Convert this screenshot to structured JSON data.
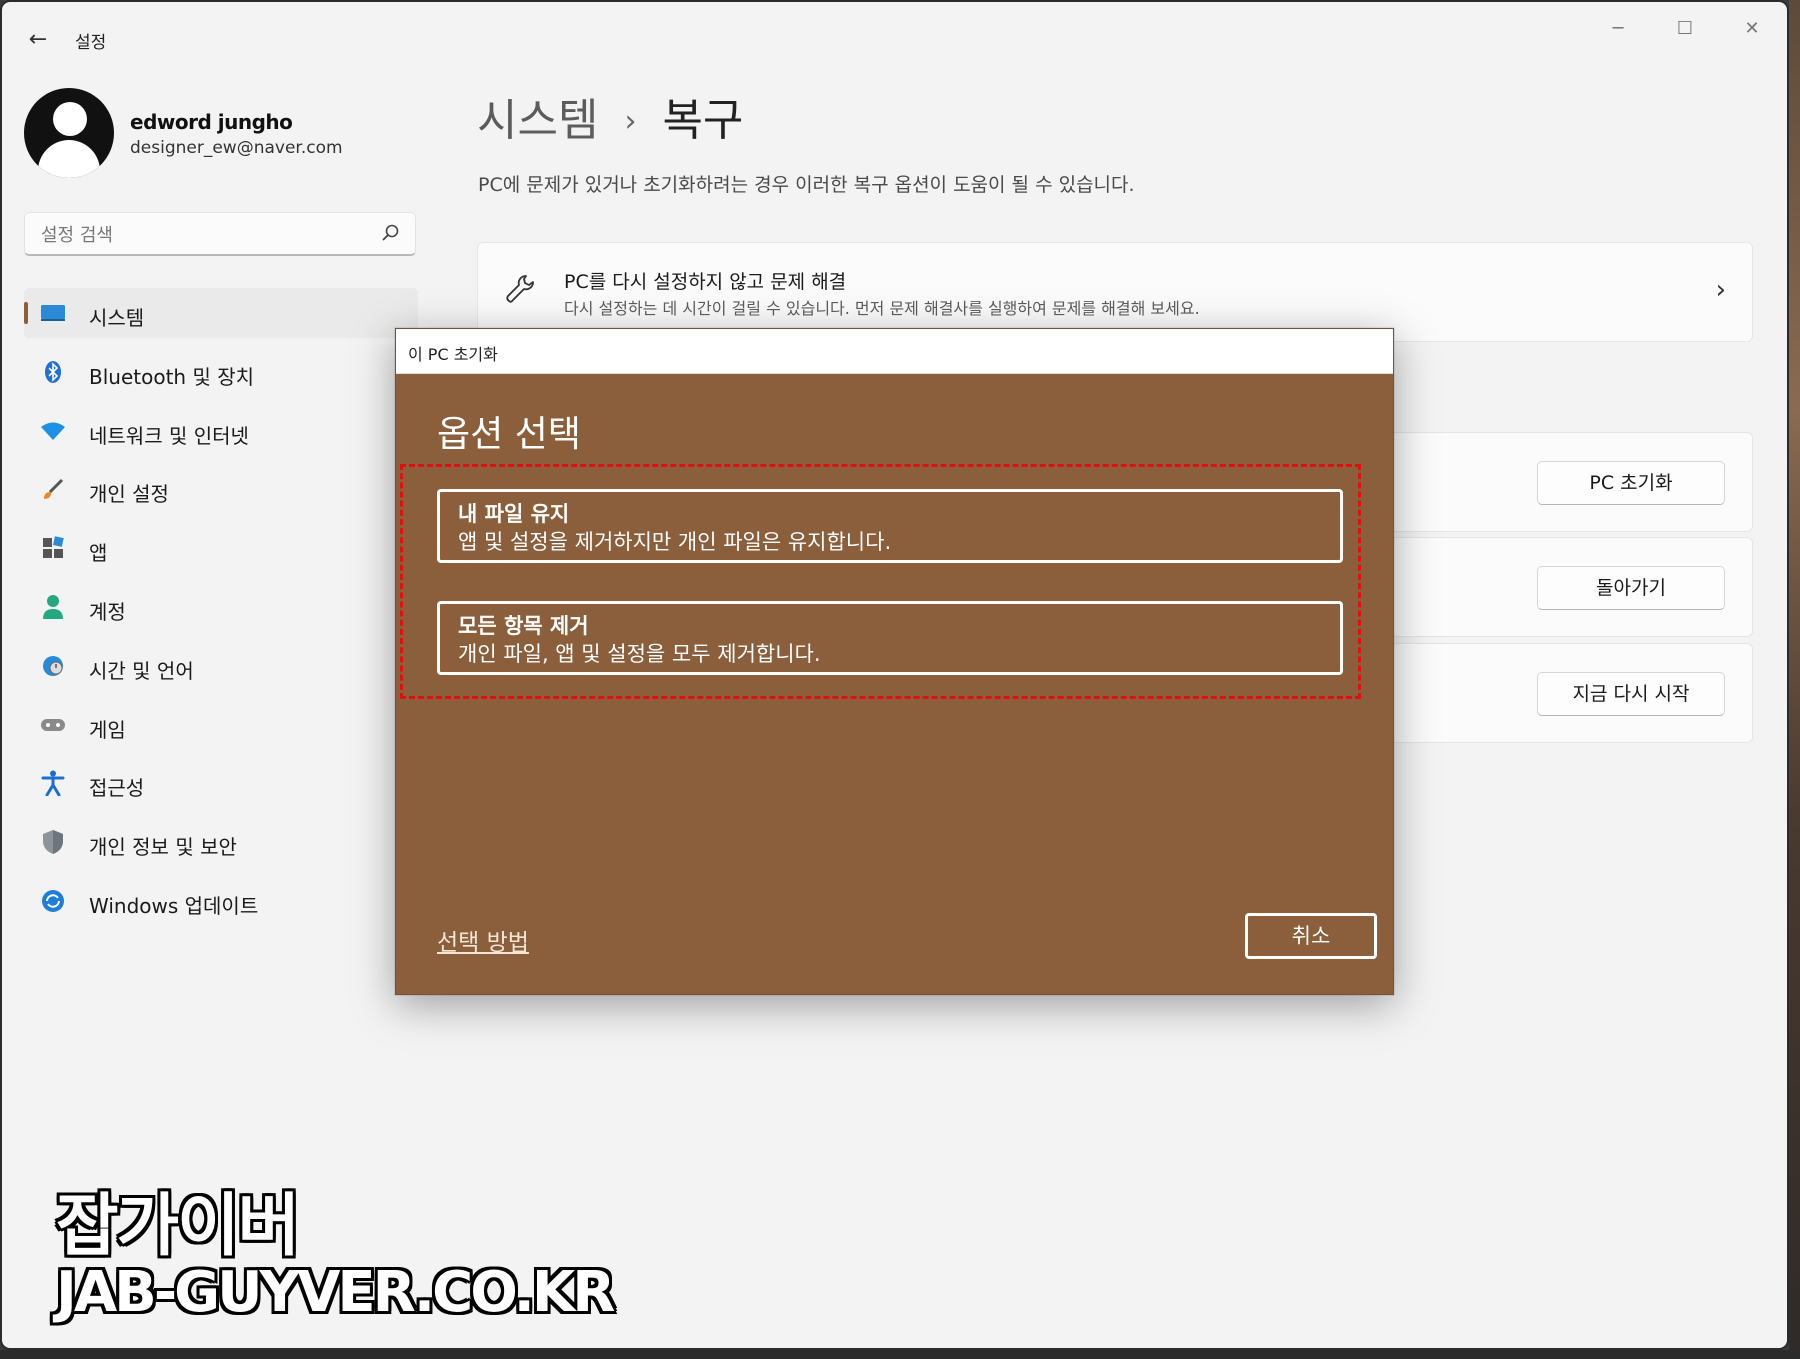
{
  "app": {
    "title": "설정",
    "back_icon": "back-arrow-icon"
  },
  "window_controls": {
    "minimize": "─",
    "maximize": "☐",
    "close": "✕"
  },
  "profile": {
    "name": "edword jungho",
    "email": "designer_ew@naver.com"
  },
  "search": {
    "placeholder": "설정 검색"
  },
  "sidebar": {
    "items": [
      {
        "label": "시스템",
        "icon": "system-icon",
        "active": true
      },
      {
        "label": "Bluetooth 및 장치",
        "icon": "bluetooth-icon"
      },
      {
        "label": "네트워크 및 인터넷",
        "icon": "wifi-icon"
      },
      {
        "label": "개인 설정",
        "icon": "brush-icon"
      },
      {
        "label": "앱",
        "icon": "apps-icon"
      },
      {
        "label": "계정",
        "icon": "account-icon"
      },
      {
        "label": "시간 및 언어",
        "icon": "globe-icon"
      },
      {
        "label": "게임",
        "icon": "gamepad-icon"
      },
      {
        "label": "접근성",
        "icon": "accessibility-icon"
      },
      {
        "label": "개인 정보 및 보안",
        "icon": "shield-icon"
      },
      {
        "label": "Windows 업데이트",
        "icon": "update-icon"
      }
    ]
  },
  "header": {
    "breadcrumb_parent": "시스템",
    "breadcrumb_sep": "›",
    "breadcrumb_current": "복구",
    "description": "PC에 문제가 있거나 초기화하려는 경우 이러한 복구 옵션이 도움이 될 수 있습니다."
  },
  "troubleshoot_card": {
    "title": "PC를 다시 설정하지 않고 문제 해결",
    "subtitle": "다시 설정하는 데 시간이 걸릴 수 있습니다. 먼저 문제 해결사를 실행하여 문제를 해결해 보세요."
  },
  "recovery_actions": {
    "reset_pc": "PC 초기화",
    "go_back": "돌아가기",
    "restart_now": "지금 다시 시작"
  },
  "dialog": {
    "window_title": "이 PC 초기화",
    "heading": "옵션 선택",
    "options": [
      {
        "title": "내 파일 유지",
        "description": "앱 및 설정을 제거하지만 개인 파일은 유지합니다."
      },
      {
        "title": "모든 항목 제거",
        "description": "개인 파일, 앱 및 설정을 모두 제거합니다."
      }
    ],
    "help_link": "선택 방법",
    "cancel": "취소",
    "colors": {
      "background": "#8b5e3c",
      "highlight": "#e01010"
    }
  },
  "watermark": {
    "line1": "잡가이버",
    "line2": "JAB-GUYVER.CO.KR"
  }
}
